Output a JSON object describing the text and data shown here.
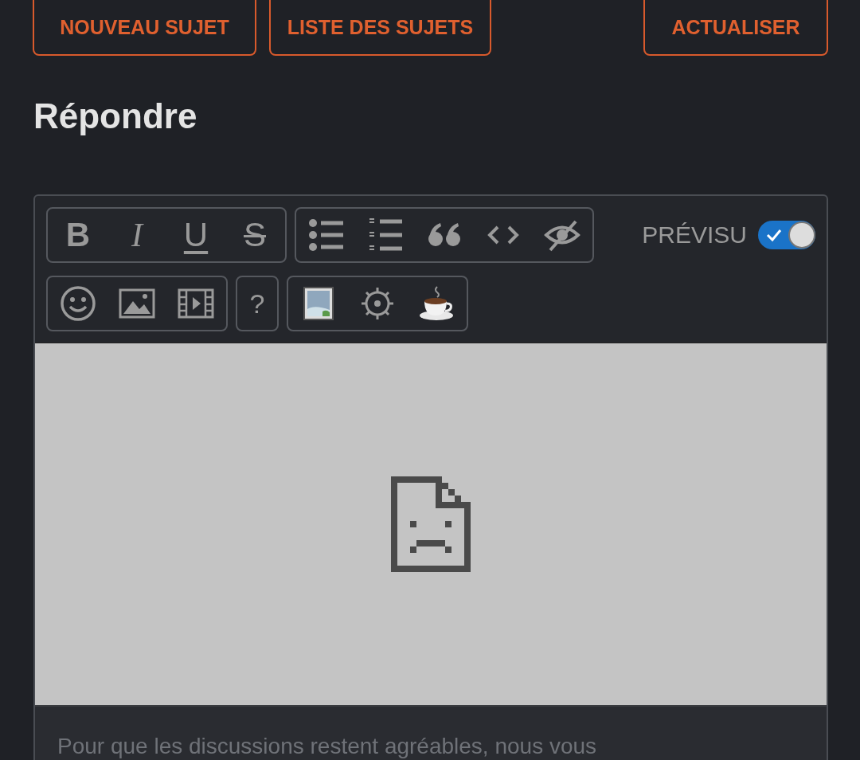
{
  "actions": [
    {
      "label": "NOUVEAU SUJET"
    },
    {
      "label": "LISTE DES SUJETS"
    },
    {
      "label": "ACTUALISER"
    }
  ],
  "heading": "Répondre",
  "editor": {
    "toolbar": [
      [
        {
          "kind": "bold",
          "label": "B"
        },
        {
          "kind": "italic",
          "label": "I"
        },
        {
          "kind": "underline",
          "label": "U"
        },
        {
          "kind": "strike",
          "label": "S"
        }
      ],
      [
        {
          "kind": "bullets"
        },
        {
          "kind": "numbers"
        },
        {
          "kind": "quote"
        },
        {
          "kind": "code"
        },
        {
          "kind": "hidden"
        }
      ],
      [
        {
          "kind": "smiley"
        },
        {
          "kind": "image"
        },
        {
          "kind": "video"
        }
      ],
      [
        {
          "kind": "plain",
          "label": "?"
        }
      ],
      [
        {
          "kind": "picture"
        },
        {
          "kind": "target"
        },
        {
          "kind": "coffee"
        }
      ]
    ],
    "preview": {
      "label": "PRÉVISU",
      "on": true
    },
    "placeholder": "Pour que les discussions restent agréables, nous vous"
  }
}
